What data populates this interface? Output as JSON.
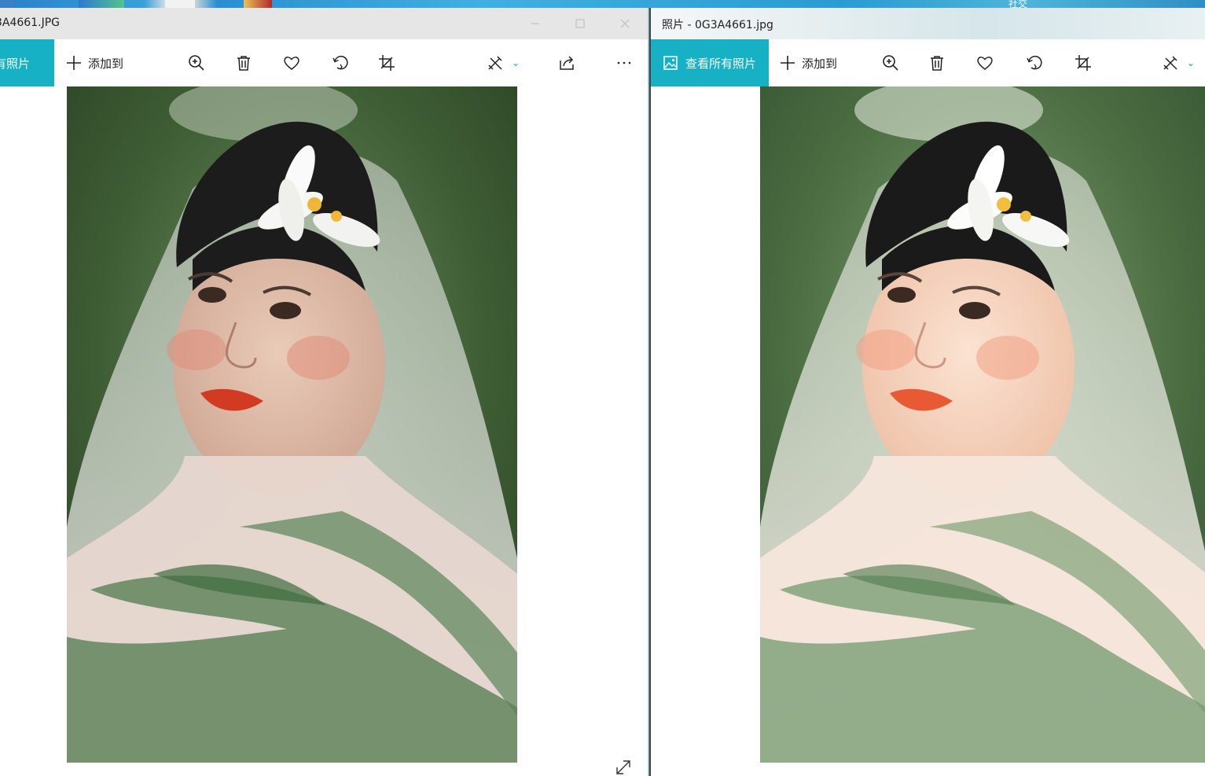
{
  "desktop": {
    "label": "社交"
  },
  "left_window": {
    "title": "3A4661.JPG",
    "view_all_label": "所有照片",
    "add_to_label": "添加到",
    "icons": [
      "zoom-in-icon",
      "delete-icon",
      "heart-icon",
      "rotate-icon",
      "crop-icon",
      "edit-icon",
      "share-icon",
      "more-icon"
    ],
    "photo_alt": "bride with veil and white flower, original colors"
  },
  "right_window": {
    "title": "照片 - 0G3A4661.jpg",
    "view_all_label": "查看所有照片",
    "add_to_label": "添加到",
    "icons": [
      "zoom-in-icon",
      "delete-icon",
      "heart-icon",
      "rotate-icon",
      "crop-icon",
      "edit-icon"
    ],
    "photo_alt": "bride with veil and white flower, retouched warmer colors"
  },
  "colors": {
    "accent": "#17b1c6",
    "chevron": "#17a2b8"
  }
}
